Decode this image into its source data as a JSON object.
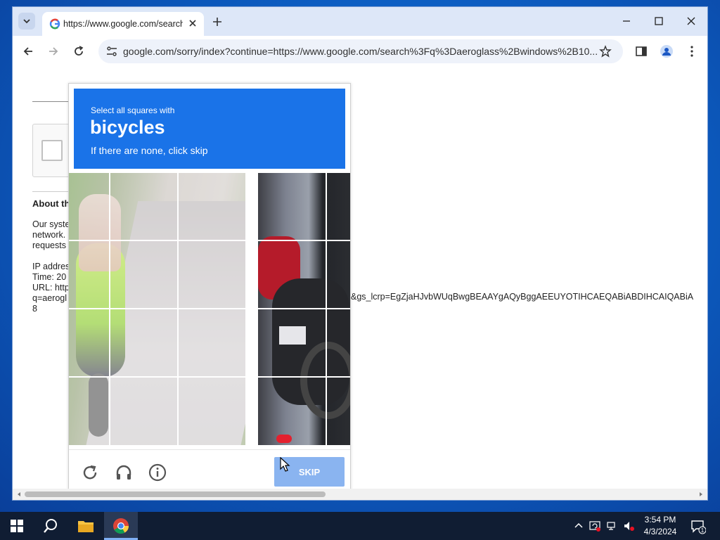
{
  "browser": {
    "tab_title": "https://www.google.com/search?q=aeroglass",
    "url": "google.com/sorry/index?continue=https://www.google.com/search%3Fq%3Daeroglass%2Bwindows%2B10..."
  },
  "page": {
    "about_title": "About th",
    "body_lines": [
      "Our syste",
      "network.",
      "requests"
    ],
    "ip_label": "IP addres",
    "time_label": "Time: 20",
    "url_label": "URL: http",
    "url_line2": "q=aerogl",
    "url_line3": "8",
    "url_overflow": "&gs_lcrp=EgZjaHJvbWUqBwgBEAAYgAQyBggAEEUYOTIHCAEQABiABDIHCAIQABiA"
  },
  "captcha": {
    "instruction": "Select all squares with",
    "target": "bicycles",
    "subtext": "If there are none, click skip",
    "skip_label": "SKIP"
  },
  "taskbar": {
    "time": "3:54 PM",
    "date": "4/3/2024",
    "notification_count": "1"
  },
  "colors": {
    "captcha_header": "#1a73e8",
    "skip_button": "#8ab4f0",
    "taskbar": "#101d33"
  }
}
